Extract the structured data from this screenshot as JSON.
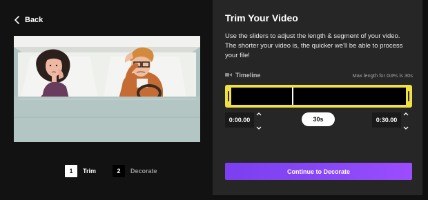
{
  "nav": {
    "back_label": "Back"
  },
  "steps": [
    {
      "number": "1",
      "label": "Trim",
      "active": true
    },
    {
      "number": "2",
      "label": "Decorate",
      "active": false
    }
  ],
  "panel": {
    "title": "Trim Your Video",
    "description": "Use the sliders to adjust the length & segment of your video. The shorter your video is, the quicker we'll be able to process your file!",
    "timeline_label": "Timeline",
    "max_length_note": "Max length for GIFs is 30s",
    "start_time": "0:00.00",
    "duration": "30s",
    "end_time": "0:30.00",
    "continue_label": "Continue to Decorate"
  },
  "colors": {
    "accent": "#8a48f7",
    "trim_border": "#f0e046",
    "panel_bg": "#262626"
  },
  "icons": {
    "back": "chevron-left-icon",
    "timeline": "video-camera-icon",
    "up": "chevron-up-icon",
    "down": "chevron-down-icon"
  }
}
